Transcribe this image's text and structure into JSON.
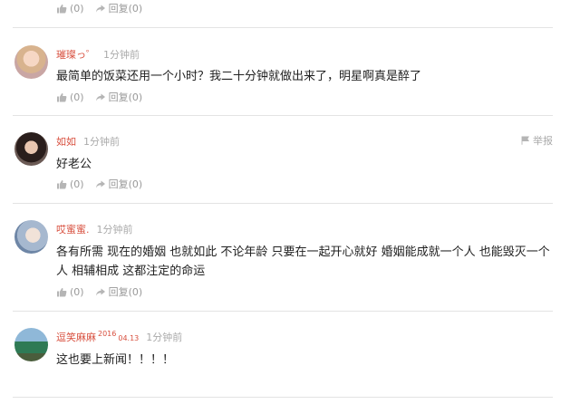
{
  "top_actions": {
    "like_count": "(0)",
    "reply_label": "回复(0)"
  },
  "comments": [
    {
      "username": "璀璨っ゜",
      "badge": "",
      "time": "1分钟前",
      "text": "最简单的饭菜还用一个小时？我二十分钟就做出来了，明星啊真是醉了",
      "like_count": "(0)",
      "reply_label": "回复(0)"
    },
    {
      "username": "如如",
      "badge": "",
      "time": "1分钟前",
      "text": "好老公",
      "like_count": "(0)",
      "reply_label": "回复(0)",
      "report_label": "举报"
    },
    {
      "username": "哎蜜蜜.",
      "badge": "",
      "time": "1分钟前",
      "text_line1": "各有所需 现在的婚姻 也就如此 不论年龄 只要在一起开心就好 婚姻能成就一个人 也能毁灭一个",
      "text_line2": "人 相辅相成 这都注定的命运",
      "like_count": "(0)",
      "reply_label": "回复(0)"
    },
    {
      "username": "逗笑麻麻",
      "badge": "2016",
      "badge_date": "04.13",
      "time": "1分钟前",
      "text": "这也要上新闻！！！！",
      "like_count": "(0)",
      "reply_label": "回复(0)"
    }
  ],
  "icons": {
    "like": "thumbs-up-icon",
    "reply": "reply-arrow-icon",
    "report": "flag-icon"
  },
  "colors": {
    "username": "#d8503f",
    "meta": "#aaaaaa",
    "divider": "#e3e3e3"
  }
}
